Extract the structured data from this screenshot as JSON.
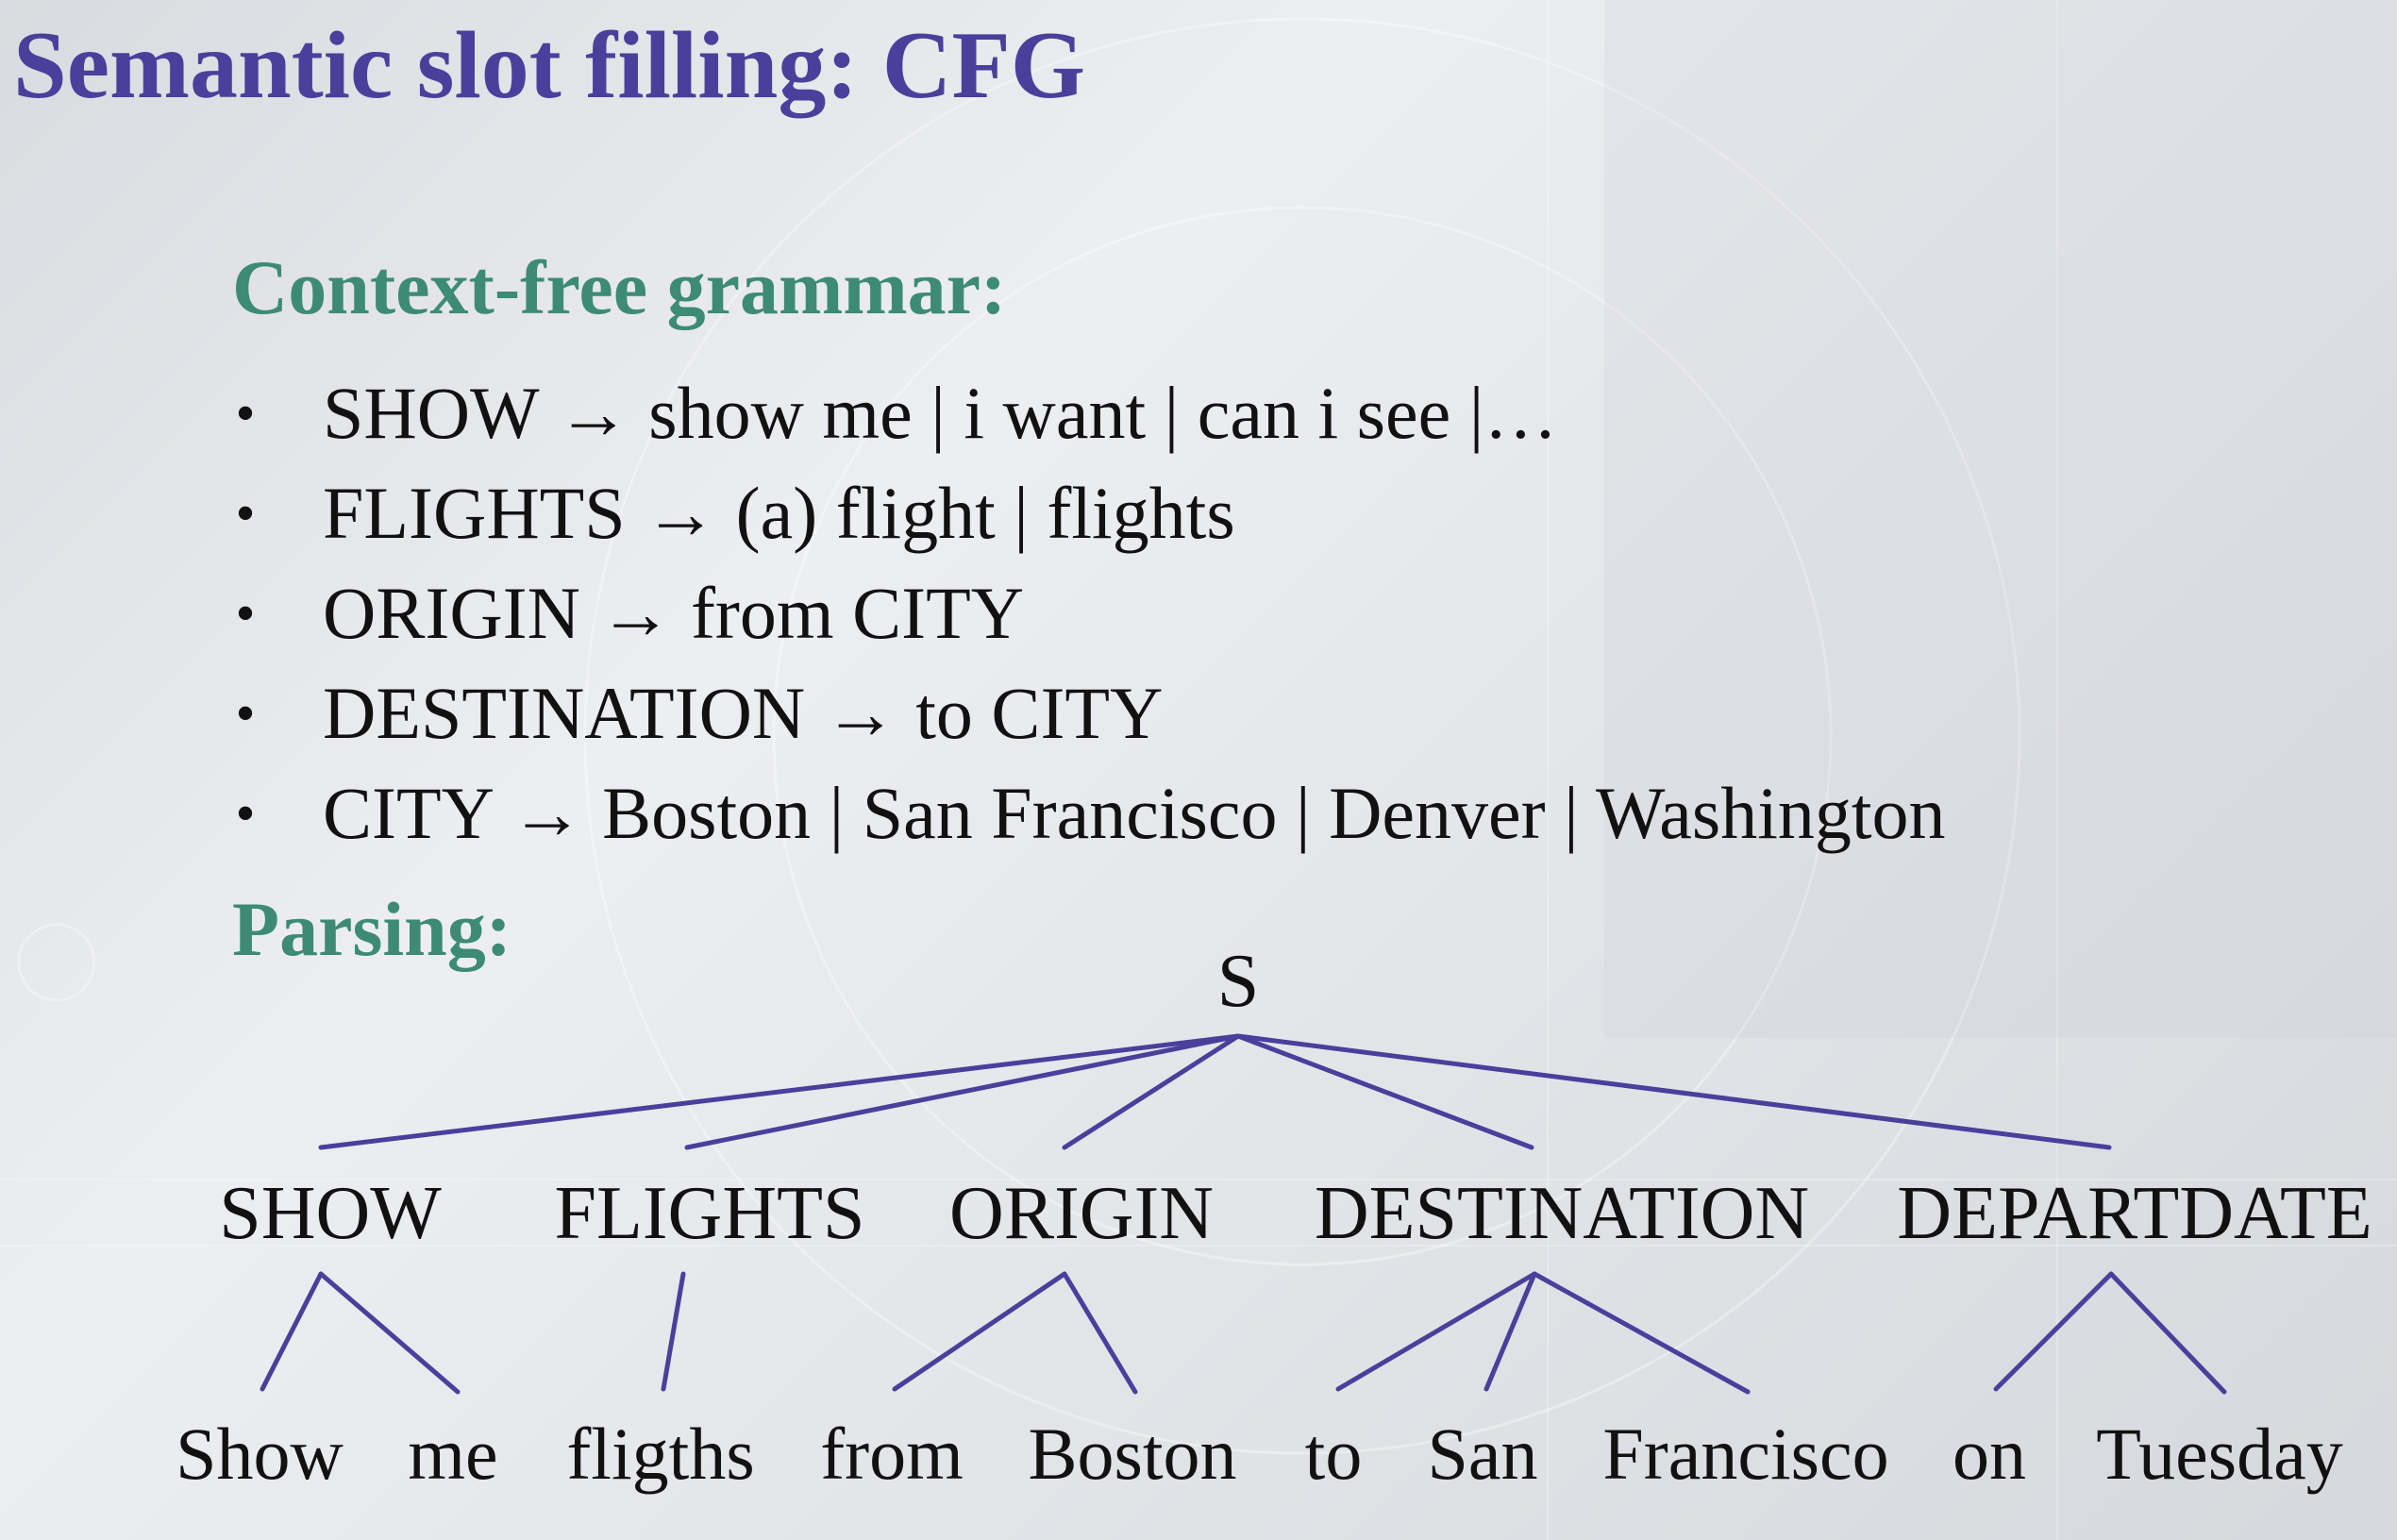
{
  "slide": {
    "title": "Semantic slot filling: CFG",
    "accent_color": "#4b3f9c",
    "heading_color": "#3d8b73"
  },
  "grammar": {
    "heading": "Context-free grammar:",
    "rules": [
      "SHOW → show me | i want | can i see |…",
      "FLIGHTS → (a) flight | flights",
      "ORIGIN →  from CITY",
      "DESTINATION →  to CITY",
      "CITY →  Boston | San Francisco | Denver | Washington"
    ]
  },
  "parsing": {
    "heading": "Parsing:",
    "tree": {
      "root": "S",
      "slots": [
        {
          "label": "SHOW",
          "words": [
            "Show",
            "me"
          ]
        },
        {
          "label": "FLIGHTS",
          "words": [
            "fligths"
          ]
        },
        {
          "label": "ORIGIN",
          "words": [
            "from",
            "Boston"
          ]
        },
        {
          "label": "DESTINATION",
          "words": [
            "to",
            "San",
            "Francisco"
          ]
        },
        {
          "label": "DEPARTDATE",
          "words": [
            "on",
            "Tuesday"
          ]
        }
      ]
    }
  }
}
